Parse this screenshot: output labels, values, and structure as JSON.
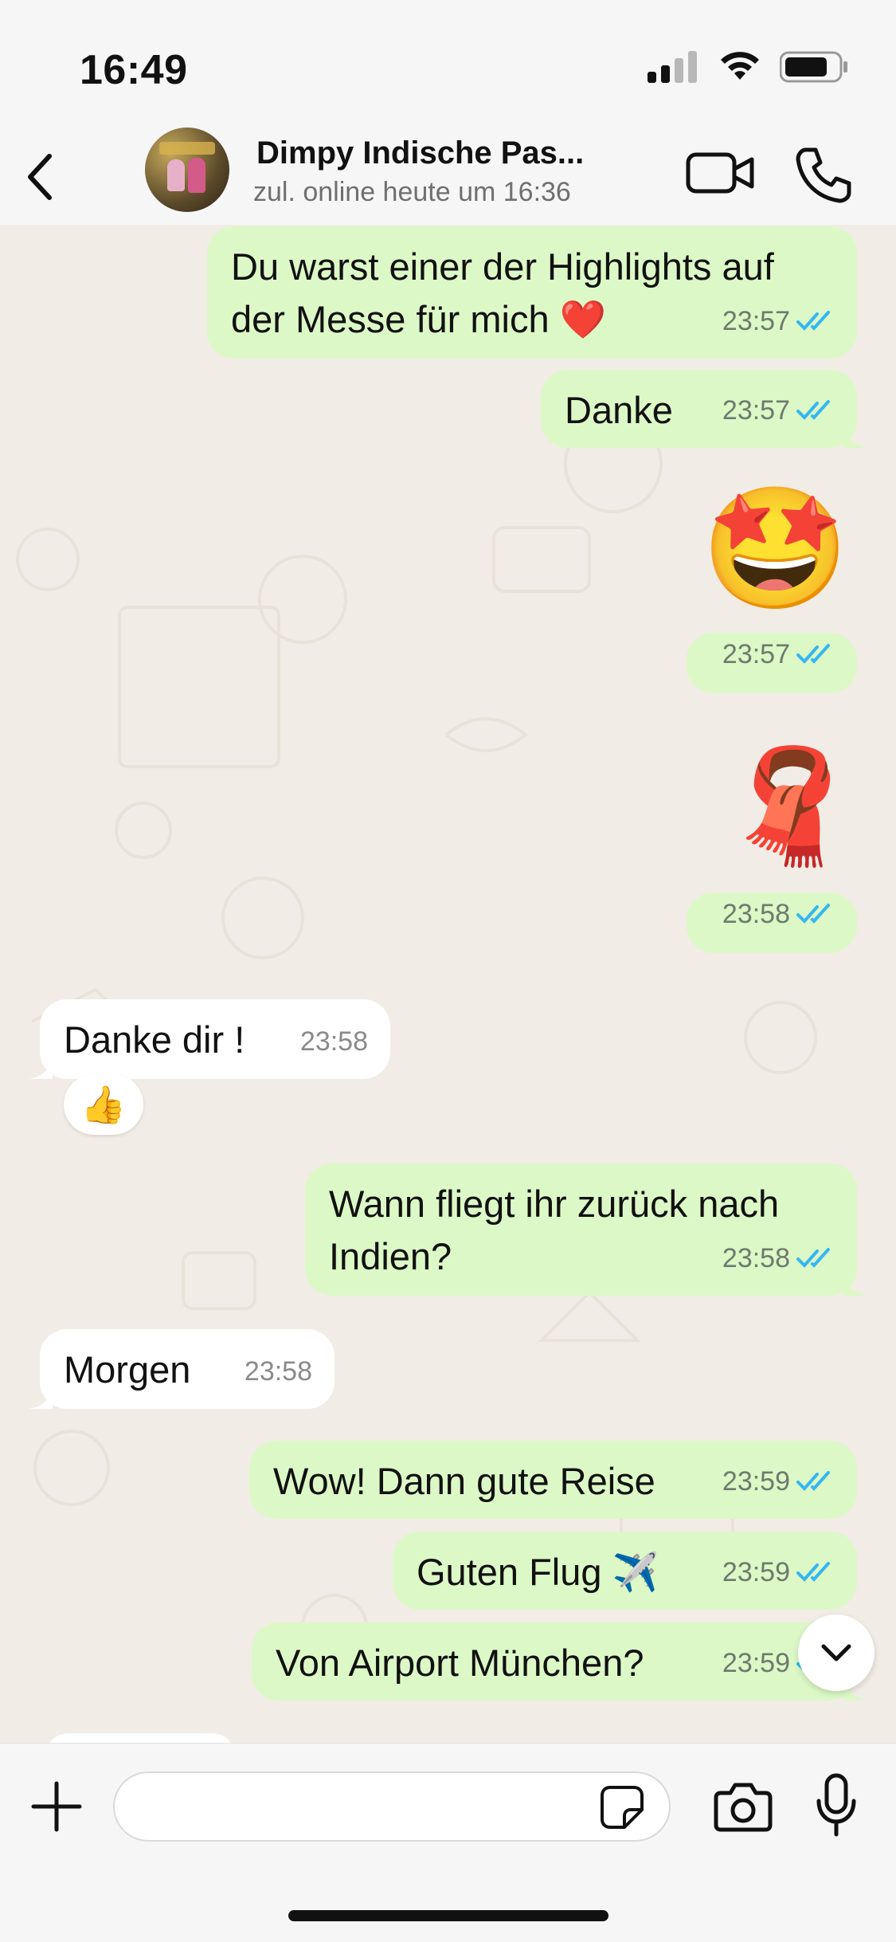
{
  "status_bar": {
    "time": "16:49"
  },
  "header": {
    "contact_name": "Dimpy Indische Pas...",
    "contact_status": "zul. online heute um 16:36"
  },
  "messages": [
    {
      "id": "m1",
      "direction": "out",
      "text": "Du warst einer der Highlights auf der Messe für mich ❤️",
      "time": "23:57",
      "read": true
    },
    {
      "id": "m2",
      "direction": "out",
      "text": "Danke",
      "time": "23:57",
      "read": true
    },
    {
      "id": "m3",
      "direction": "out",
      "emoji": "🤩",
      "time": "23:57",
      "read": true
    },
    {
      "id": "m4",
      "direction": "out",
      "emoji": "🧣",
      "time": "23:58",
      "read": true
    },
    {
      "id": "m5",
      "direction": "in",
      "text": "Danke dir !",
      "time": "23:58",
      "reaction": "👍"
    },
    {
      "id": "m6",
      "direction": "out",
      "text": "Wann fliegt ihr zurück nach Indien?",
      "time": "23:58",
      "read": true
    },
    {
      "id": "m7",
      "direction": "in",
      "text": "Morgen",
      "time": "23:58"
    },
    {
      "id": "m8",
      "direction": "out",
      "text": "Wow! Dann gute Reise",
      "time": "23:59",
      "read": true
    },
    {
      "id": "m9",
      "direction": "out",
      "text": "Guten Flug ✈️",
      "time": "23:59",
      "read": true
    },
    {
      "id": "m10",
      "direction": "out",
      "text": "Von Airport München?",
      "time": "23:59",
      "read": true
    }
  ],
  "composer": {
    "placeholder": ""
  },
  "colors": {
    "outgoing_bubble": "#dcf8c6",
    "incoming_bubble": "#ffffff",
    "read_tick": "#34b7f1"
  }
}
